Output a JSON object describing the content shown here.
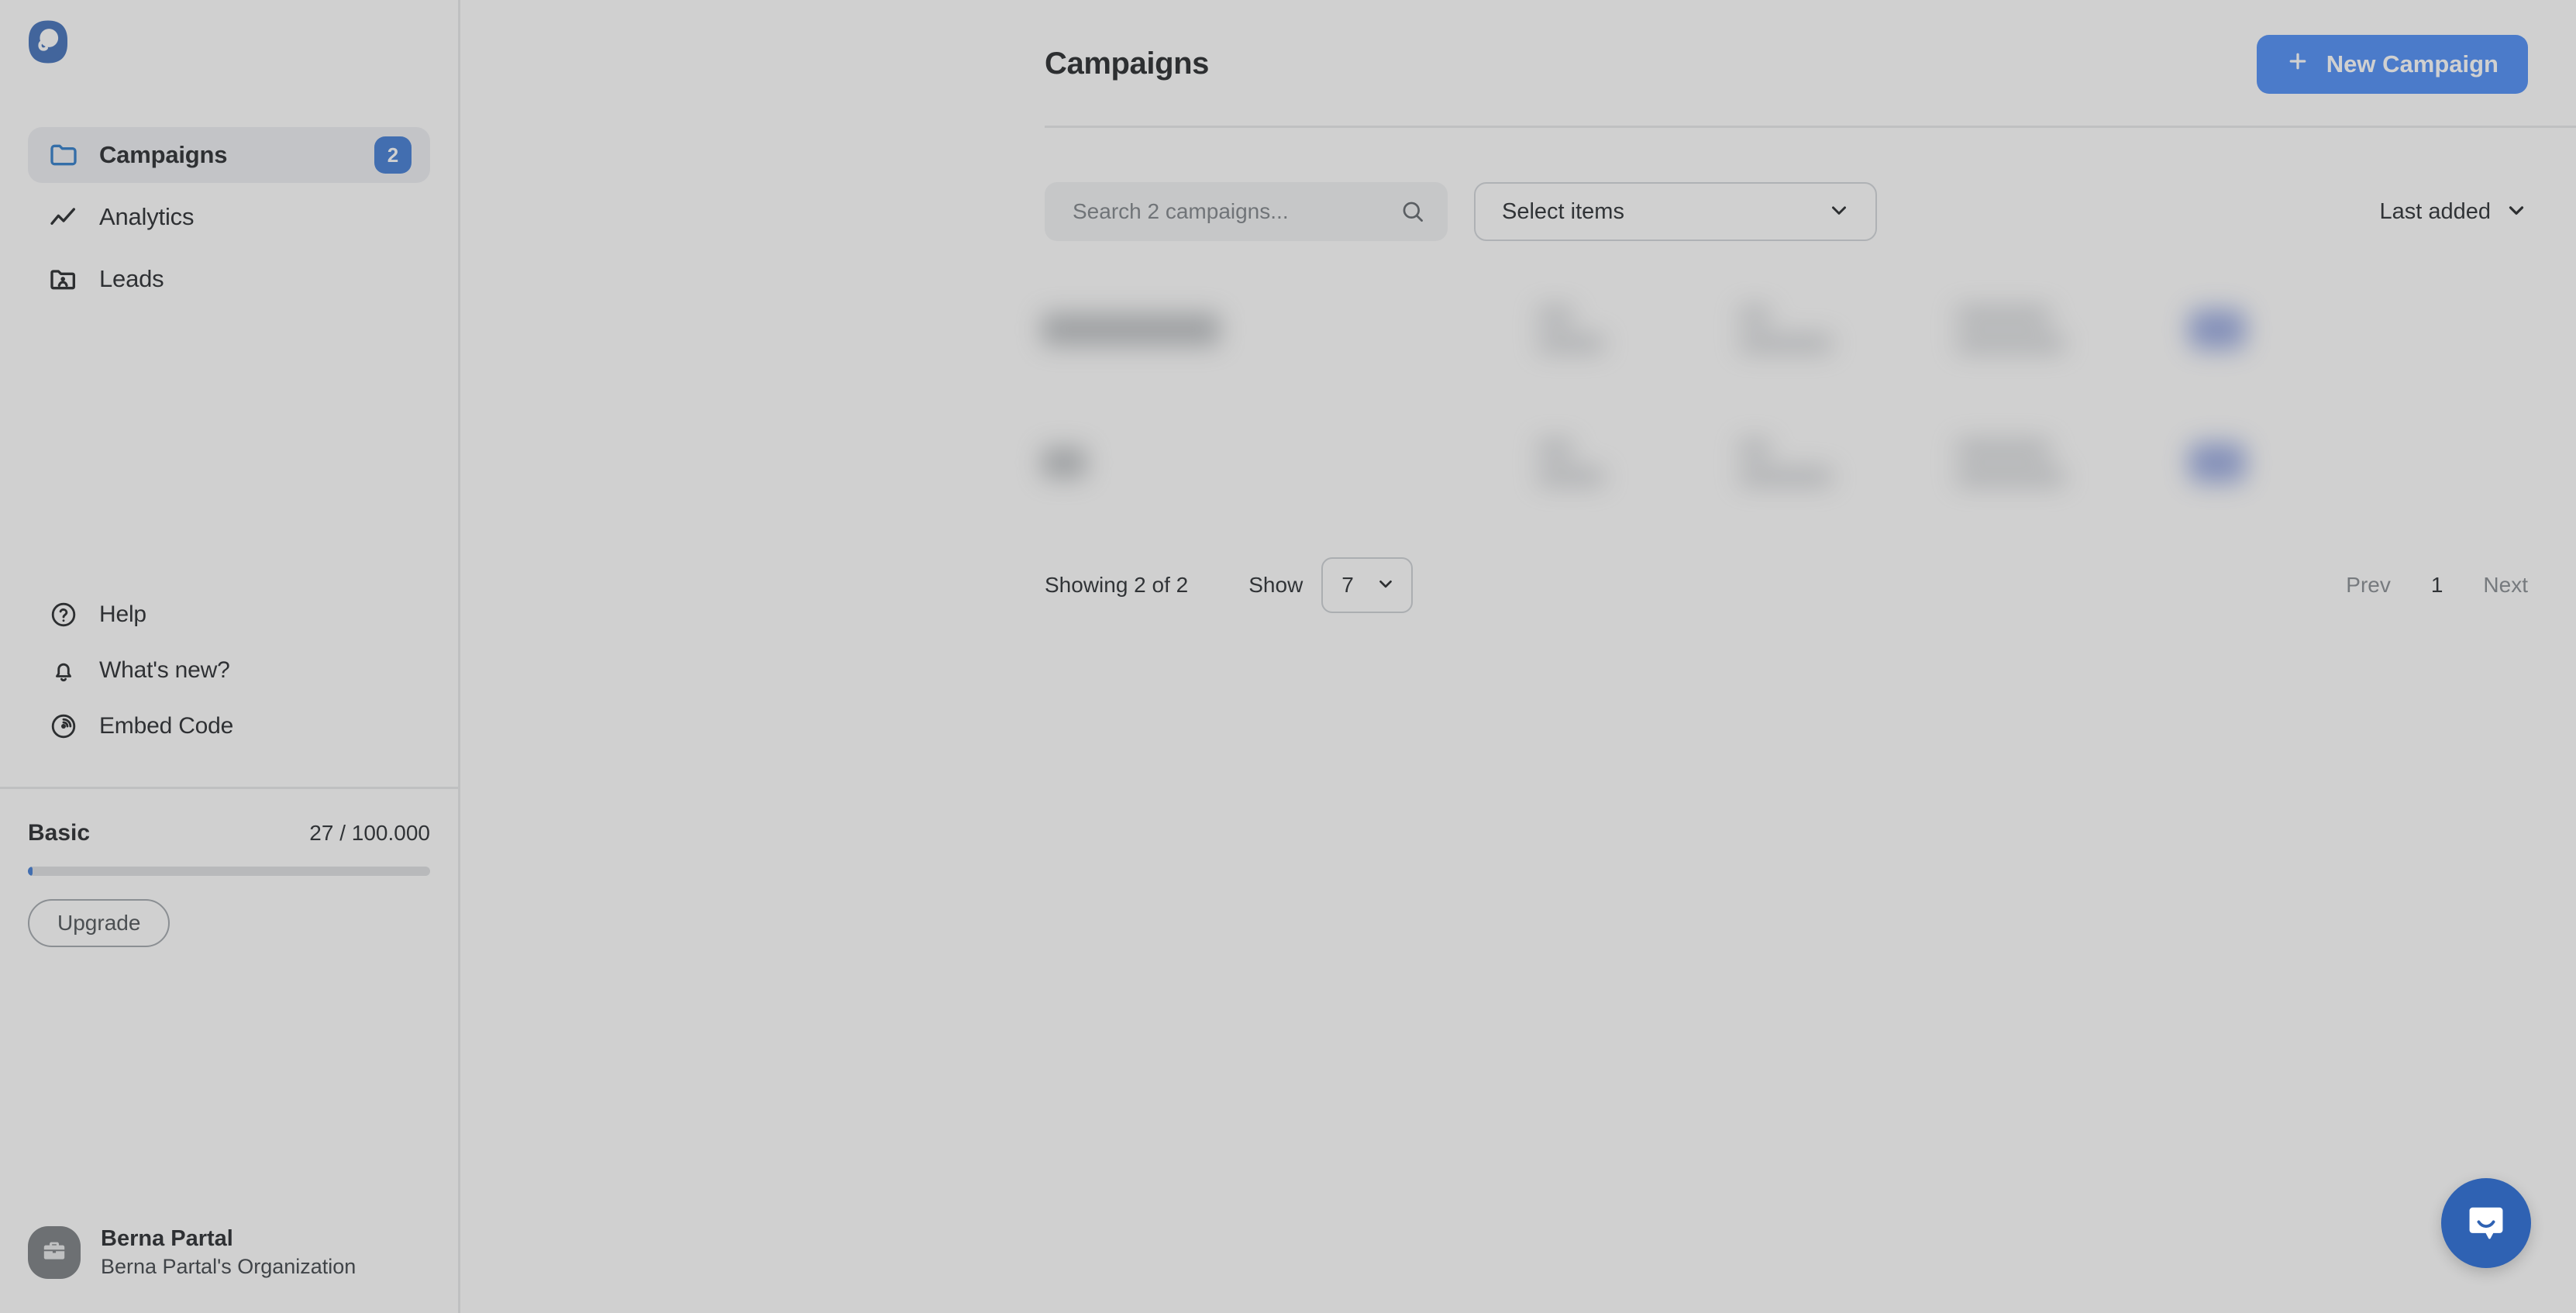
{
  "brand": {
    "logo_icon": "popupsmart-logo-icon",
    "accent": "#3b82f6",
    "badge_color": "#2f6fd0"
  },
  "sidebar": {
    "nav": [
      {
        "label": "Campaigns",
        "icon": "folder-icon",
        "badge": "2",
        "active": true
      },
      {
        "label": "Analytics",
        "icon": "line-chart-icon",
        "badge": "",
        "active": false
      },
      {
        "label": "Leads",
        "icon": "folder-user-icon",
        "badge": "",
        "active": false
      }
    ],
    "utility": [
      {
        "label": "Help",
        "icon": "question-circle-icon"
      },
      {
        "label": "What's new?",
        "icon": "bell-icon"
      },
      {
        "label": "Embed Code",
        "icon": "broadcast-icon"
      }
    ],
    "plan": {
      "name": "Basic",
      "quota": "27 / 100.000",
      "progress_percent": 0.027,
      "upgrade_label": "Upgrade"
    },
    "user": {
      "name": "Berna Partal",
      "organization": "Berna Partal's Organization",
      "avatar_icon": "briefcase-icon"
    }
  },
  "header": {
    "title": "Campaigns",
    "new_campaign_label": "New Campaign",
    "new_campaign_icon": "plus-icon"
  },
  "toolbar": {
    "search_placeholder": "Search 2 campaigns...",
    "search_value": "",
    "search_icon": "search-icon",
    "select_items_label": "Select items",
    "select_items_icon": "chevron-down-icon",
    "sort_label": "Last added",
    "sort_icon": "chevron-down-icon"
  },
  "table": {
    "rows_blurred": true,
    "row_count": 2
  },
  "footer": {
    "showing_text": "Showing 2 of 2",
    "show_label": "Show",
    "show_value": "7",
    "show_icon": "chevron-down-icon",
    "prev_label": "Prev",
    "page_label": "1",
    "next_label": "Next"
  },
  "messenger": {
    "icon": "intercom-chat-icon"
  }
}
